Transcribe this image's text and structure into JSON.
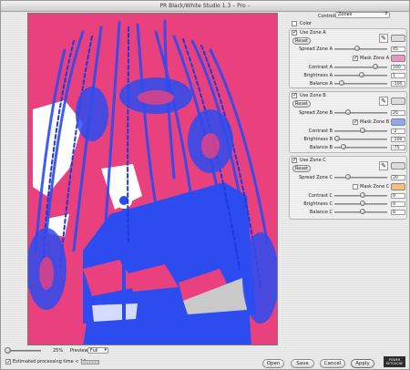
{
  "window": {
    "title": "PR Black/White Studio 1.3 – Pro –"
  },
  "controls": {
    "label": "Controls",
    "value": "Zones"
  },
  "color": {
    "label": "Color",
    "checked": false
  },
  "zones": [
    {
      "enable_label": "Use Zone A",
      "enabled": true,
      "reset": "Reset",
      "swatch_color": "#dcdcdc",
      "mask_label": "Mask Zone A",
      "mask_checked": true,
      "mask_color": "#e896c4",
      "spread_label": "Spread Zone A",
      "spread_value": "45",
      "contrast_label": "Contrast A",
      "contrast_value": "100",
      "brightness_label": "Brightness A",
      "brightness_value": "1",
      "balance_label": "Balance A",
      "balance_value": "-100",
      "eyedropper_icon": "eyedropper-icon"
    },
    {
      "enable_label": "Use Zone B",
      "enabled": true,
      "reset": "Reset",
      "swatch_color": "#dcdcdc",
      "mask_label": "Mask Zone B",
      "mask_checked": true,
      "mask_color": "#8fa6f3",
      "spread_label": "Spread Zone B",
      "spread_value": "20",
      "contrast_label": "Contrast B",
      "contrast_value": "-2",
      "brightness_label": "Brightness B",
      "brightness_value": "-100",
      "balance_label": "Balance B",
      "balance_value": "-75",
      "eyedropper_icon": "eyedropper-icon"
    },
    {
      "enable_label": "Use Zone C",
      "enabled": true,
      "reset": "Reset",
      "swatch_color": "#dcdcdc",
      "mask_label": "Mask Zone C",
      "mask_checked": false,
      "mask_color": "#f7bf7a",
      "spread_label": "Spread Zone C",
      "spread_value": "20",
      "contrast_label": "Contrast C",
      "contrast_value": "0",
      "brightness_label": "Brightness C",
      "brightness_value": "0",
      "balance_label": "Balance C",
      "balance_value": "0",
      "eyedropper_icon": "eyedropper-icon"
    }
  ],
  "footer": {
    "zoom_percent": "25%",
    "preview_label": "Preview",
    "preview_value": "Full",
    "estimated_label": "Estimated processing time < 12 sec.",
    "estimated_checked": true,
    "open": "Open",
    "save": "Save",
    "cancel": "Cancel",
    "apply": "Apply",
    "logo_line1": "POWER",
    "logo_line2": "RETOUCHE"
  },
  "colors": {
    "preview_pink": "#e8417e",
    "preview_blue": "#2c4cf0",
    "preview_white": "#ffffff"
  }
}
